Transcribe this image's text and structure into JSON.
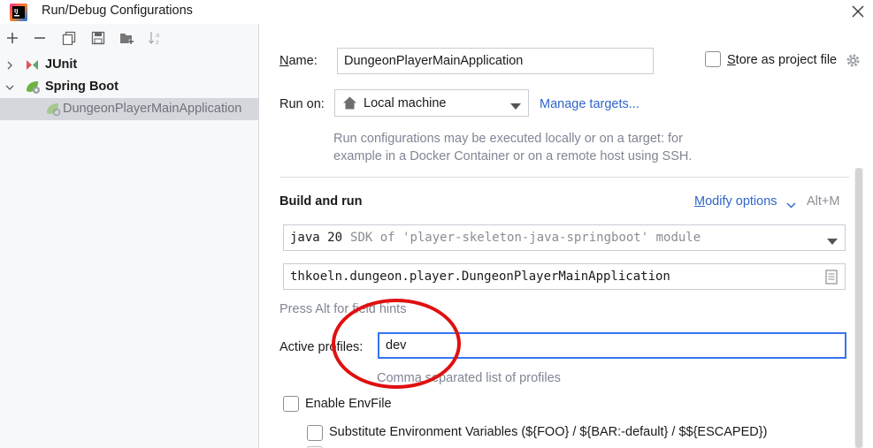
{
  "window": {
    "title": "Run/Debug Configurations"
  },
  "toolbar": {
    "icons": [
      "add-icon",
      "remove-icon",
      "copy-icon",
      "save-icon",
      "new-folder-icon",
      "sort-icon"
    ]
  },
  "tree": {
    "junit": "JUnit",
    "spring_boot": "Spring Boot",
    "app_item": "DungeonPlayerMainApplication"
  },
  "form": {
    "name_label": "Name:",
    "name_value": "DungeonPlayerMainApplication",
    "store_label": "Store as project file",
    "run_on_label": "Run on:",
    "run_on_value": "Local machine",
    "manage_targets": "Manage targets...",
    "run_hint_1": "Run configurations may be executed locally or on a target: for",
    "run_hint_2": "example in a Docker Container or on a remote host using SSH.",
    "build_run": "Build and run",
    "modify_options": "Modify options",
    "modify_shortcut": "Alt+M",
    "jdk_java": "java 20",
    "jdk_sdk": "SDK of 'player-skeleton-java-springboot' module",
    "main_class": "thkoeln.dungeon.player.DungeonPlayerMainApplication",
    "alt_hint": "Press Alt for field hints",
    "active_profiles_label": "Active profiles:",
    "active_profiles_value": "dev",
    "profiles_hint": "Comma separated list of profiles",
    "enable_envfile": "Enable EnvFile",
    "substitute_env": "Substitute Environment Variables (${FOO} / ${BAR:-default} / $${ESCAPED})"
  },
  "colors": {
    "link": "#2f65ca",
    "annotation_circle": "#e01010",
    "selection": "#d5d7dc"
  }
}
